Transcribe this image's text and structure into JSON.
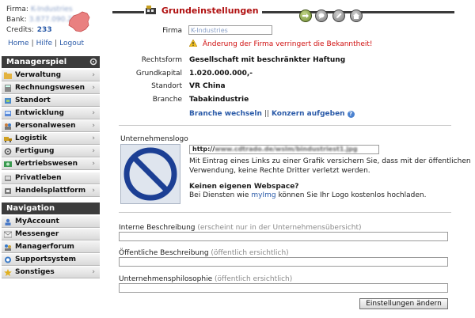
{
  "user": {
    "firma_label": "Firma:",
    "firma_value": "K-Industries",
    "bank_label": "Bank:",
    "bank_value": "3.877.090.284",
    "credits_label": "Credits:",
    "credits_value": "233",
    "links": [
      "Home",
      "Hilfe",
      "Logout"
    ]
  },
  "managerspiel": {
    "title": "Managerspiel",
    "items": [
      {
        "label": "Verwaltung",
        "arrow": "›"
      },
      {
        "label": "Rechnungswesen",
        "arrow": "›"
      },
      {
        "label": "Standort",
        "arrow": ""
      },
      {
        "label": "Entwicklung",
        "arrow": "›"
      },
      {
        "label": "Personalwesen",
        "arrow": "›"
      },
      {
        "label": "Logistik",
        "arrow": "›"
      },
      {
        "label": "Fertigung",
        "arrow": "›"
      },
      {
        "label": "Vertriebswesen",
        "arrow": "›"
      },
      {
        "label": "Privatleben",
        "arrow": ""
      },
      {
        "label": "Handelsplattform",
        "arrow": "›"
      }
    ]
  },
  "navigation": {
    "title": "Navigation",
    "items": [
      {
        "label": "MyAccount"
      },
      {
        "label": "Messenger"
      },
      {
        "label": "Managerforum"
      },
      {
        "label": "Supportsystem"
      },
      {
        "label": "Sonstiges",
        "arrow": "›"
      }
    ]
  },
  "page": {
    "title": "Grundeinstellungen"
  },
  "firma": {
    "label": "Firma",
    "value": "K-Industries",
    "warning": "Änderung der Firma verringert die Bekanntheit!"
  },
  "details": [
    {
      "label": "Rechtsform",
      "value": "Gesellschaft mit beschränkter Haftung"
    },
    {
      "label": "Grundkapital",
      "value": "1.020.000.000,-"
    },
    {
      "label": "Standort",
      "value": "VR China"
    },
    {
      "label": "Branche",
      "value": "Tabakindustrie"
    }
  ],
  "actions": {
    "branche_wechseln": "Branche wechseln",
    "separator": "||",
    "konzern_aufgeben": "Konzern aufgeben",
    "help": "?"
  },
  "logo": {
    "title": "Unternehmenslogo",
    "url_prefix": "http://",
    "url_blurred": "www.cdtrado.de/wslm/bindustriest1.jpg",
    "line1": "Mit Eintrag eines Links zu einer Grafik versichern Sie, dass mit der öffentlichen",
    "line2": "Verwendung, keine Rechte Dritter verletzt werden.",
    "no_webspace_heading": "Keinen eigenen Webspace?",
    "no_webspace_pre": "Bei Diensten wie",
    "no_webspace_link": "myImg",
    "no_webspace_post": "können Sie Ihr Logo kostenlos hochladen."
  },
  "descriptions": {
    "intern_label": "Interne Beschreibung",
    "intern_hint": "(erscheint nur in der Unternehmensübersicht)",
    "intern_value": "",
    "public_label": "Öffentliche Beschreibung",
    "public_hint": "(öffentlich ersichtlich)",
    "public_value": "",
    "philosophy_label": "Unternehmensphilosophie",
    "philosophy_hint": "(öffentlich ersichtlich)",
    "philosophy_value": ""
  },
  "submit_label": "Einstellungen ändern",
  "colors": {
    "title_red": "#b01010",
    "link_blue": "#2a5aa8",
    "warning_red": "#d01010",
    "sidebar_header": "#3c3c3c",
    "no_entry_blue": "#1c3f94"
  }
}
